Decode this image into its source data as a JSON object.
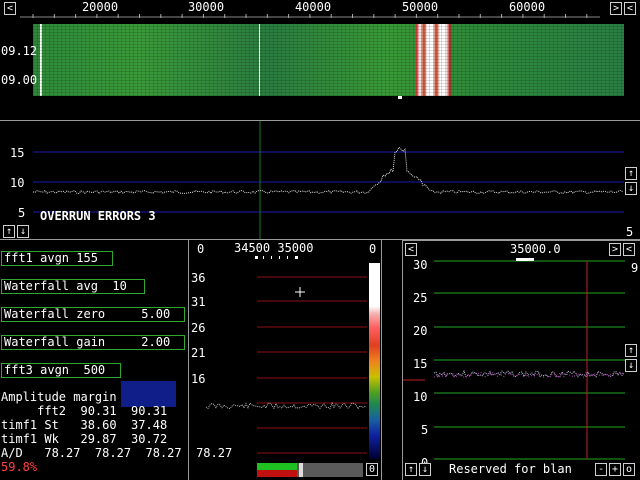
{
  "waterfall": {
    "freq_labels": [
      "20000",
      "30000",
      "40000",
      "50000",
      "60000"
    ],
    "time_labels": [
      "09.12",
      "09.00"
    ]
  },
  "spectrum": {
    "y_labels": [
      "15",
      "10",
      "5"
    ],
    "overrun_text": "OVERRUN ERRORS 3",
    "corner_value": "5"
  },
  "params": {
    "fft1_avgn": "fft1 avgn 155",
    "waterfall_avg": "Waterfall avg  10",
    "waterfall_zero": "Waterfall zero     5.00",
    "waterfall_gain": "Waterfall gain     2.00",
    "fft3_avgn": "fft3 avgn  500"
  },
  "stats": {
    "amplitude_margin": "Amplitude margin",
    "fft2": "     fft2  90.31  90.31",
    "timf1_st": "timf1 St   38.60  37.48",
    "timf1_wk": "timf1 Wk   29.87  30.72",
    "ad": "A/D   78.27  78.27  78.27  78.27",
    "cpu": "59.8%"
  },
  "baseband": {
    "left_zero": "0",
    "right_zero": "0",
    "freq_label": "34500 35000",
    "y_labels": [
      "36",
      "31",
      "26",
      "21",
      "16"
    ],
    "bottom_zero": "0"
  },
  "hires": {
    "freq_label": "35000.0",
    "right_value": "9",
    "y_labels": [
      "30",
      "25",
      "20",
      "15",
      "10",
      "5",
      "0"
    ],
    "reserved_text": "Reserved for blan",
    "btn_minus": "-",
    "btn_plus": "+",
    "btn_o": "o"
  },
  "arrows": {
    "left": "<",
    "right": ">",
    "up": "↑",
    "down": "↓"
  },
  "colors": {
    "green_border": "#2ea82e",
    "grid_blue": "#1a1ab0",
    "grid_red": "#8b1010",
    "grid_green": "#22a822",
    "cpu_red": "#ff4040"
  }
}
